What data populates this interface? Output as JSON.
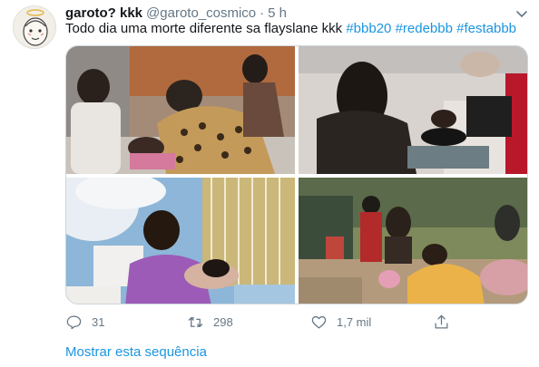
{
  "tweet": {
    "author_name": "garoto? kkk",
    "author_handle": "@garoto_cosmico",
    "separator": "·",
    "time": "5 h",
    "text_plain": "Todo dia uma morte diferente sa flayslane kkk ",
    "hashtags": [
      "#bbb20",
      "#redebbb",
      "#festabbb"
    ]
  },
  "actions": {
    "reply_count": "31",
    "retweet_count": "298",
    "like_count": "1,7 mil"
  },
  "thread_link": "Mostrar esta sequência",
  "icons": {
    "avatar": "avatar",
    "menu": "chevron-down-icon",
    "reply": "reply-icon",
    "retweet": "retweet-icon",
    "like": "heart-icon",
    "share": "share-icon"
  },
  "colors": {
    "link": "#1b95e0",
    "muted": "#657786",
    "text": "#14171a",
    "border": "#ccd6dd"
  }
}
